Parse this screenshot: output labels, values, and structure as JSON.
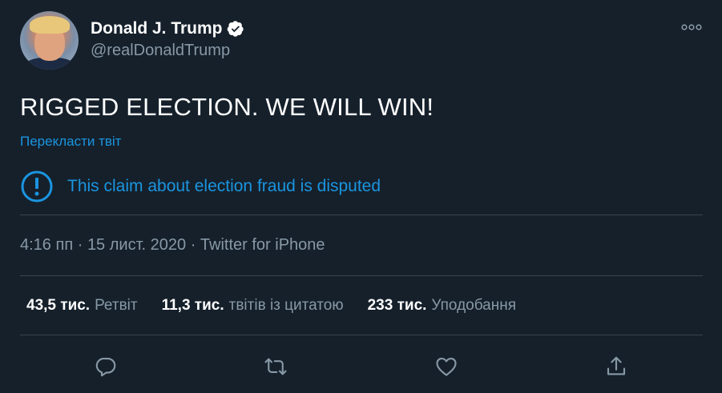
{
  "author": {
    "display_name": "Donald J. Trump",
    "handle": "@realDonaldTrump",
    "verified": true
  },
  "tweet": {
    "text": "RIGGED ELECTION. WE WILL WIN!",
    "translate_label": "Перекласти твіт",
    "notice_text": "This claim about election fraud is disputed"
  },
  "meta": {
    "time": "4:16 пп",
    "separator": " · ",
    "date": "15 лист. 2020",
    "source": "Twitter for iPhone"
  },
  "stats": [
    {
      "count": "43,5 тис.",
      "label": "Ретвіт"
    },
    {
      "count": "11,3 тис.",
      "label": "твітів із цитатою"
    },
    {
      "count": "233 тис.",
      "label": "Уподобання"
    }
  ],
  "icons": {
    "verified": "verified-badge-icon",
    "more": "more-options-icon",
    "notice": "exclamation-circle-icon",
    "reply": "reply-icon",
    "retweet": "retweet-icon",
    "like": "heart-icon",
    "share": "share-icon"
  },
  "colors": {
    "background": "#15202b",
    "text_primary": "#ffffff",
    "text_secondary": "#8899a6",
    "accent": "#1b95e0",
    "divider": "#38444d"
  }
}
